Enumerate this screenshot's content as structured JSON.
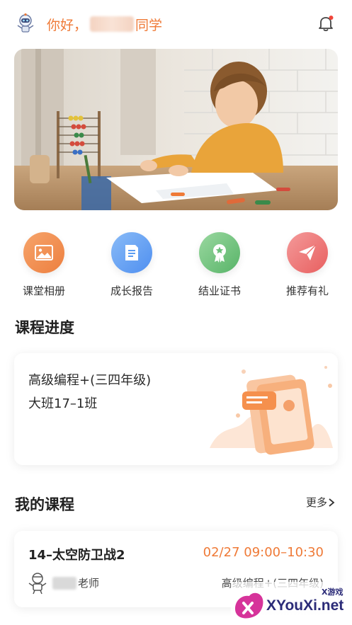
{
  "header": {
    "greeting_prefix": "你好，",
    "greeting_suffix": "同学"
  },
  "quick_actions": [
    {
      "label": "课堂相册",
      "icon": "photo-album-icon",
      "color": "#f08a4b"
    },
    {
      "label": "成长报告",
      "icon": "report-icon",
      "color": "#5b9cf2"
    },
    {
      "label": "结业证书",
      "icon": "certificate-icon",
      "color": "#6cc07a"
    },
    {
      "label": "推荐有礼",
      "icon": "send-gift-icon",
      "color": "#ee6b6b"
    }
  ],
  "progress": {
    "title": "课程进度",
    "course": "高级编程+(三四年级)",
    "class_name": "大班17–1班"
  },
  "my_courses": {
    "title": "我的课程",
    "more": "更多",
    "lesson": {
      "title": "14–太空防卫战2",
      "time": "02/27 09:00–10:30",
      "teacher_suffix": "老师",
      "course": "高级编程+(三四年级)"
    }
  },
  "watermark": {
    "text": "XYouXi.net",
    "small": "X游戏"
  },
  "colors": {
    "accent": "#ef7a37"
  }
}
